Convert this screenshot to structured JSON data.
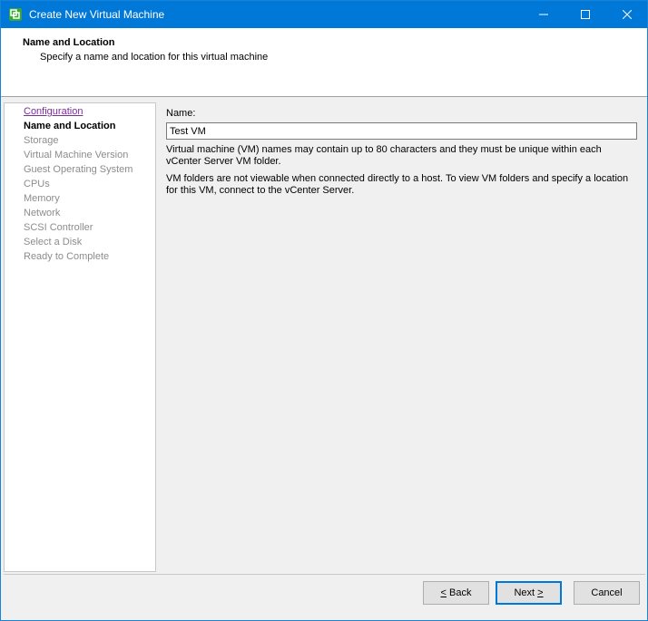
{
  "window": {
    "title": "Create New Virtual Machine",
    "accent": "#0078d7"
  },
  "header": {
    "title": "Name and Location",
    "subtitle": "Specify a name and location for this virtual machine"
  },
  "nav": {
    "items": [
      {
        "label": "Configuration",
        "state": "visited"
      },
      {
        "label": "Name and Location",
        "state": "current"
      },
      {
        "label": "Storage",
        "state": "upcoming"
      },
      {
        "label": "Virtual Machine Version",
        "state": "upcoming"
      },
      {
        "label": "Guest Operating System",
        "state": "upcoming"
      },
      {
        "label": "CPUs",
        "state": "upcoming"
      },
      {
        "label": "Memory",
        "state": "upcoming"
      },
      {
        "label": "Network",
        "state": "upcoming"
      },
      {
        "label": "SCSI Controller",
        "state": "upcoming"
      },
      {
        "label": "Select a Disk",
        "state": "upcoming"
      },
      {
        "label": "Ready to Complete",
        "state": "upcoming"
      }
    ]
  },
  "form": {
    "name_label": "Name:",
    "name_value": "Test VM",
    "help_line_1a": "Virtual machine (VM) names may contain up to 80 characters and they must be unique within each",
    "help_line_1b": "vCenter Server VM folder.",
    "help_line_2a": "VM folders are not viewable when connected directly to a host. To view VM folders and specify a location",
    "help_line_2b": "for this VM, connect to the vCenter Server."
  },
  "buttons": {
    "back_mnemonic": "<",
    "back_rest": " Back",
    "next_main": "Next ",
    "next_mnemonic": ">",
    "cancel": "Cancel"
  },
  "icons": {
    "app": "vsphere-client-icon",
    "minimize": "minimize-icon",
    "maximize": "maximize-icon",
    "close": "close-icon"
  }
}
